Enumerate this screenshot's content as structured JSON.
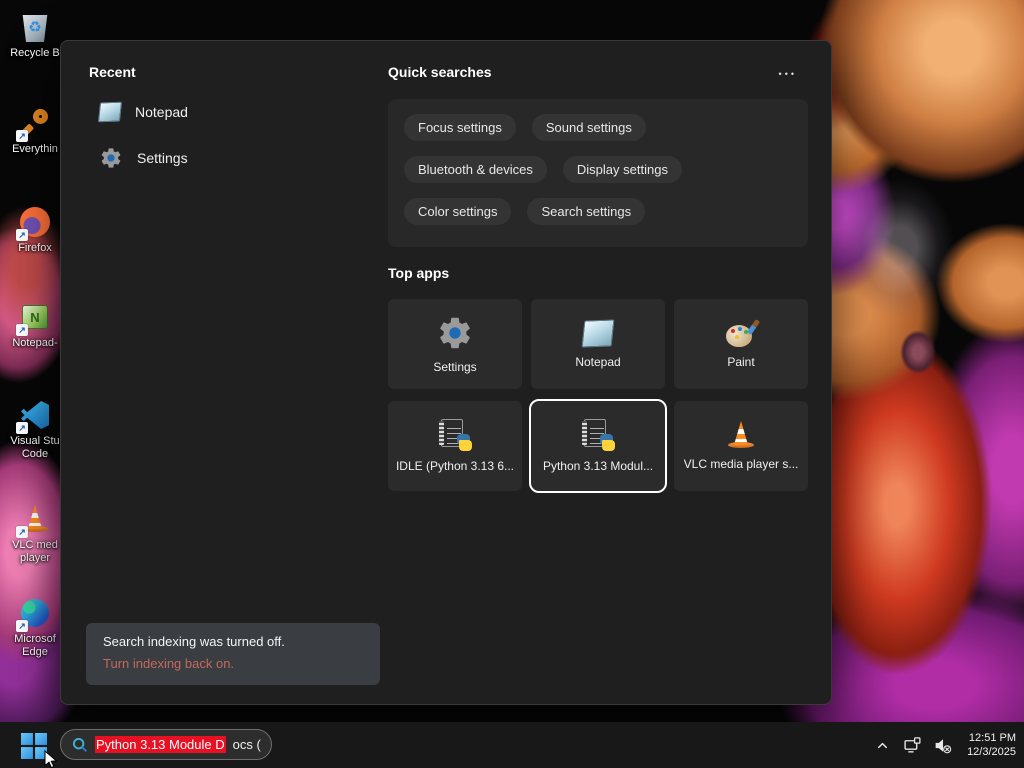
{
  "desktop": {
    "icons": [
      {
        "label": "Recycle B",
        "icon": "recycle-bin-icon"
      },
      {
        "label": "Everythin",
        "icon": "everything-search-icon"
      },
      {
        "label": "Firefox",
        "icon": "firefox-icon"
      },
      {
        "label": "Notepad-",
        "icon": "notepad-plus-plus-icon"
      },
      {
        "label": "Visual Stu Code",
        "icon": "vscode-icon"
      },
      {
        "label": "VLC med player",
        "icon": "vlc-cone-icon"
      },
      {
        "label": "Microsof Edge",
        "icon": "edge-icon"
      }
    ]
  },
  "search_panel": {
    "recent": {
      "title": "Recent",
      "items": [
        {
          "label": "Notepad",
          "icon": "notepad-icon"
        },
        {
          "label": "Settings",
          "icon": "gear-icon"
        }
      ]
    },
    "quick_searches": {
      "title": "Quick searches",
      "more_label": "•••",
      "chips": [
        "Focus settings",
        "Sound settings",
        "Bluetooth & devices",
        "Display settings",
        "Color settings",
        "Search settings"
      ]
    },
    "top_apps": {
      "title": "Top apps",
      "tiles": [
        {
          "label": "Settings",
          "icon": "gear-icon",
          "selected": false
        },
        {
          "label": "Notepad",
          "icon": "notepad-icon",
          "selected": false
        },
        {
          "label": "Paint",
          "icon": "paint-palette-icon",
          "selected": false
        },
        {
          "label": "IDLE (Python 3.13 6...",
          "icon": "python-document-icon",
          "selected": false
        },
        {
          "label": "Python 3.13 Modul...",
          "icon": "python-document-icon",
          "selected": true
        },
        {
          "label": "VLC media player s...",
          "icon": "vlc-cone-icon",
          "selected": false
        }
      ]
    },
    "indexing_notice": {
      "message": "Search indexing was turned off.",
      "action_link": "Turn indexing back on."
    }
  },
  "taskbar": {
    "search_box": {
      "selected_text": "Python 3.13 Module D",
      "unselected_text": "ocs ("
    },
    "tray": {
      "time": "12:51 PM",
      "date": "12/3/2025"
    }
  },
  "colors": {
    "selection_red": "#e81123",
    "notice_link": "#c4695e",
    "windows_blue": "#4cc2ff"
  }
}
